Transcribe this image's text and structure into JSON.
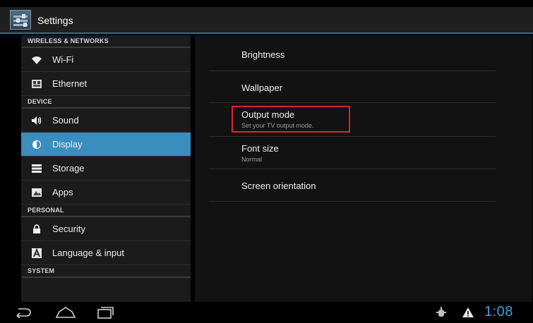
{
  "app": {
    "title": "Settings",
    "icon": "settings-icon"
  },
  "sidebar": {
    "groups": [
      {
        "header": "WIRELESS & NETWORKS",
        "items": [
          {
            "label": "Wi-Fi",
            "icon": "wifi-icon"
          },
          {
            "label": "Ethernet",
            "icon": "ethernet-icon"
          }
        ]
      },
      {
        "header": "DEVICE",
        "items": [
          {
            "label": "Sound",
            "icon": "sound-icon"
          },
          {
            "label": "Display",
            "icon": "display-icon",
            "selected": true
          },
          {
            "label": "Storage",
            "icon": "storage-icon"
          },
          {
            "label": "Apps",
            "icon": "apps-icon"
          }
        ]
      },
      {
        "header": "PERSONAL",
        "items": [
          {
            "label": "Security",
            "icon": "lock-icon"
          },
          {
            "label": "Language & input",
            "icon": "keyboard-icon"
          }
        ]
      },
      {
        "header": "SYSTEM",
        "items": []
      }
    ]
  },
  "display_settings": {
    "items": [
      {
        "title": "Brightness",
        "summary": ""
      },
      {
        "title": "Wallpaper",
        "summary": ""
      },
      {
        "title": "Output mode",
        "summary": "Set your TV output mode."
      },
      {
        "title": "Font size",
        "summary": "Normal"
      },
      {
        "title": "Screen orientation",
        "summary": ""
      }
    ]
  },
  "statusbar": {
    "time": "1:08",
    "status_icons": [
      "usb-debug-icon",
      "warning-icon"
    ]
  },
  "navbar": {
    "buttons": [
      "back-button",
      "home-button",
      "recent-apps-button"
    ]
  },
  "colors": {
    "accent": "#3a8ebd",
    "highlight_box": "#d52630",
    "clock": "#3ba3d8",
    "actionbar": "#1f1f1f"
  }
}
